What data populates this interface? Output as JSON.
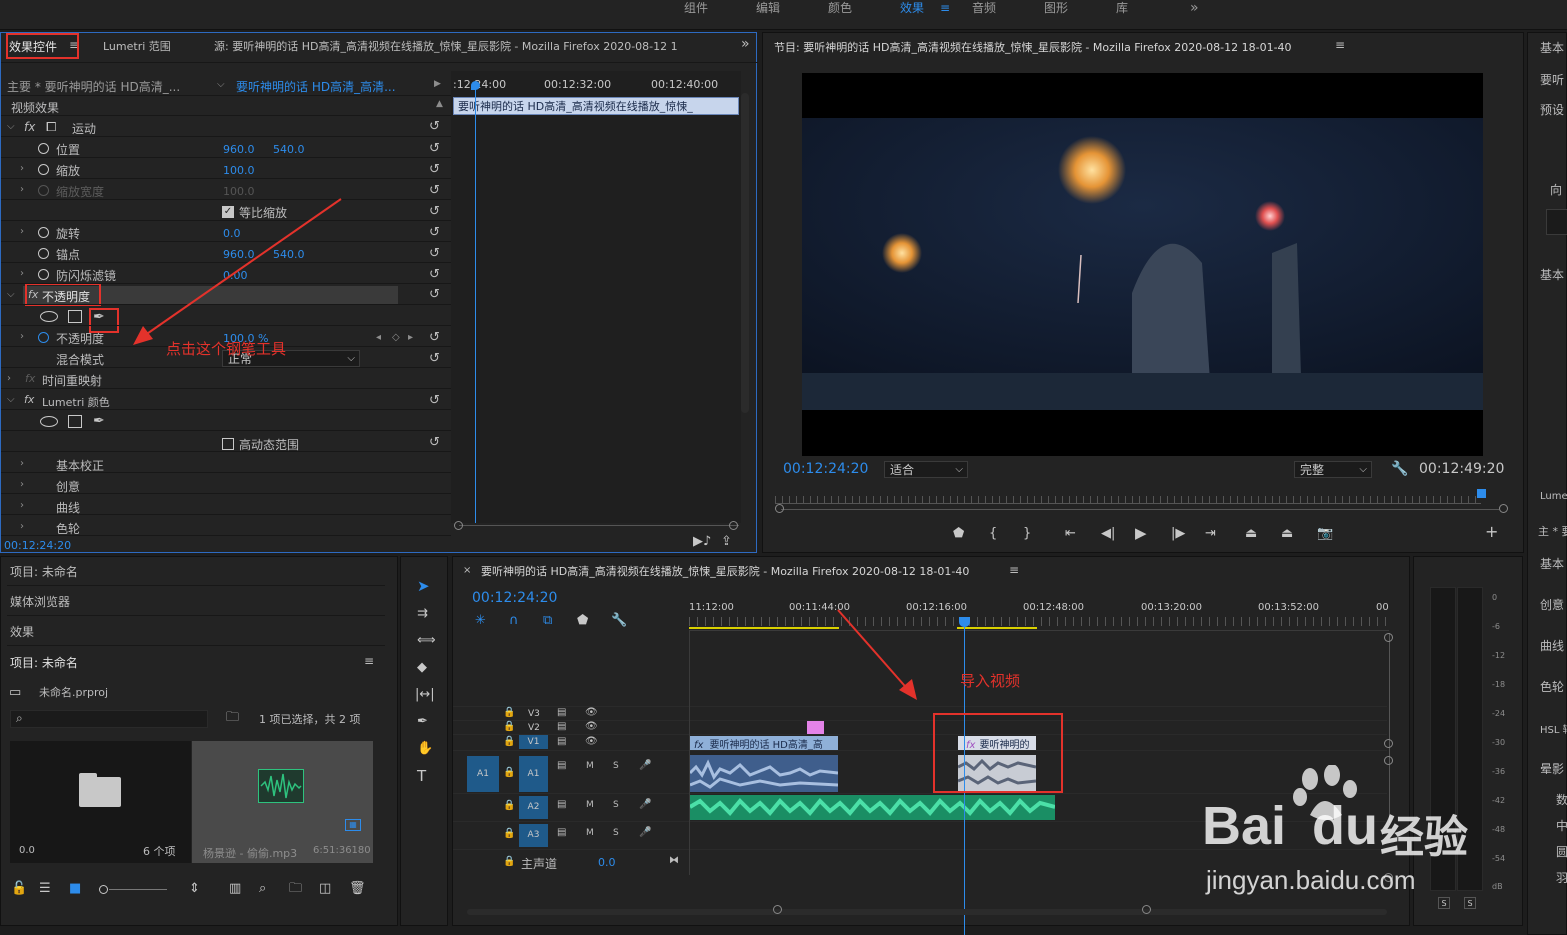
{
  "workspace_tabs": [
    "组件",
    "编辑",
    "颜色",
    "效果",
    "音频",
    "图形",
    "库"
  ],
  "workspace_active": "效果",
  "workspace_more": "»",
  "effect_controls": {
    "tab_effect": "效果控件",
    "tab_lumetri": "Lumetri 范围",
    "tab_source": "源: 要听神明的话 HD高清_高清视频在线播放_惊悚_星辰影院 - Mozilla Firefox 2020-08-12 1",
    "master_label": "主要 * 要听神明的话 HD高清_...",
    "clip_select": "要听神明的话 HD高清_高清...",
    "time_1": ":12:24:00",
    "time_2": "00:12:32:00",
    "time_3": "00:12:40:00",
    "clip_bar": "要听神明的话 HD高清_高清视频在线播放_惊悚_",
    "section_video": "视频效果",
    "motion": "运动",
    "position": "位置",
    "position_x": "960.0",
    "position_y": "540.0",
    "scale": "缩放",
    "scale_val": "100.0",
    "scale_width": "缩放宽度",
    "scale_width_val": "100.0",
    "uniform": "等比缩放",
    "rotation": "旋转",
    "rotation_val": "0.0",
    "anchor": "锚点",
    "anchor_x": "960.0",
    "anchor_y": "540.0",
    "flicker": "防闪烁滤镜",
    "flicker_val": "0.00",
    "opacity": "不透明度",
    "opacity_prop": "不透明度",
    "opacity_val": "100.0 %",
    "blend": "混合模式",
    "blend_val": "正常",
    "time_remap": "时间重映射",
    "lumetri": "Lumetri 颜色",
    "hdr": "高动态范围",
    "basic": "基本校正",
    "creative": "创意",
    "curves": "曲线",
    "wheels": "色轮",
    "timecode": "00:12:24:20",
    "annotation": "点击这个钢笔工具"
  },
  "program": {
    "title": "节目: 要听神明的话 HD高清_高清视频在线播放_惊悚_星辰影院 - Mozilla Firefox 2020-08-12 18-01-40",
    "timecode": "00:12:24:20",
    "fit": "适合",
    "quality": "完整",
    "duration": "00:12:49:20"
  },
  "right_panel": {
    "items": [
      "基本",
      "要听",
      "预设",
      "向",
      "基本",
      "Lume",
      "主 * 要",
      "基本",
      "创意",
      "曲线",
      "色轮",
      "HSL 辅",
      "晕影",
      "数",
      "中",
      "圆",
      "羽"
    ]
  },
  "project": {
    "tab1": "项目: 未命名",
    "tab2": "媒体浏览器",
    "tab3": "效果",
    "tab4": "项目: 未命名",
    "file": "未命名.prproj",
    "selection": "1 项已选择，共 2 项",
    "bin_count": "6 个项",
    "bin_val": "0.0",
    "audio_name": "杨景逊 - 偷偷.mp3",
    "audio_dur": "6:51:36180"
  },
  "timeline": {
    "title": "要听神明的话 HD高清_高清视频在线播放_惊悚_星辰影院 - Mozilla Firefox 2020-08-12 18-01-40",
    "timecode": "00:12:24:20",
    "ruler": [
      "11:12:00",
      "00:11:44:00",
      "00:12:16:00",
      "00:12:48:00",
      "00:13:20:00",
      "00:13:52:00",
      "00"
    ],
    "tracks_v": [
      "V3",
      "V2",
      "V1"
    ],
    "tracks_a": [
      "A1",
      "A2",
      "A3"
    ],
    "src_a1": "A1",
    "master": "主声道",
    "master_val": "0.0",
    "clip1": "要听神明的话 HD高清_高",
    "clip2": "要听神明的",
    "annotation": "导入视频",
    "m": "M",
    "s": "S"
  },
  "meter": {
    "labels": [
      "0",
      "-6",
      "-12",
      "-18",
      "-24",
      "-30",
      "-36",
      "-42",
      "-48",
      "-54",
      "dB"
    ],
    "s": "S"
  },
  "watermark": {
    "brand": "Bai",
    "brand2": "du",
    "cn": "经验",
    "url": "jingyan.baidu.com"
  }
}
